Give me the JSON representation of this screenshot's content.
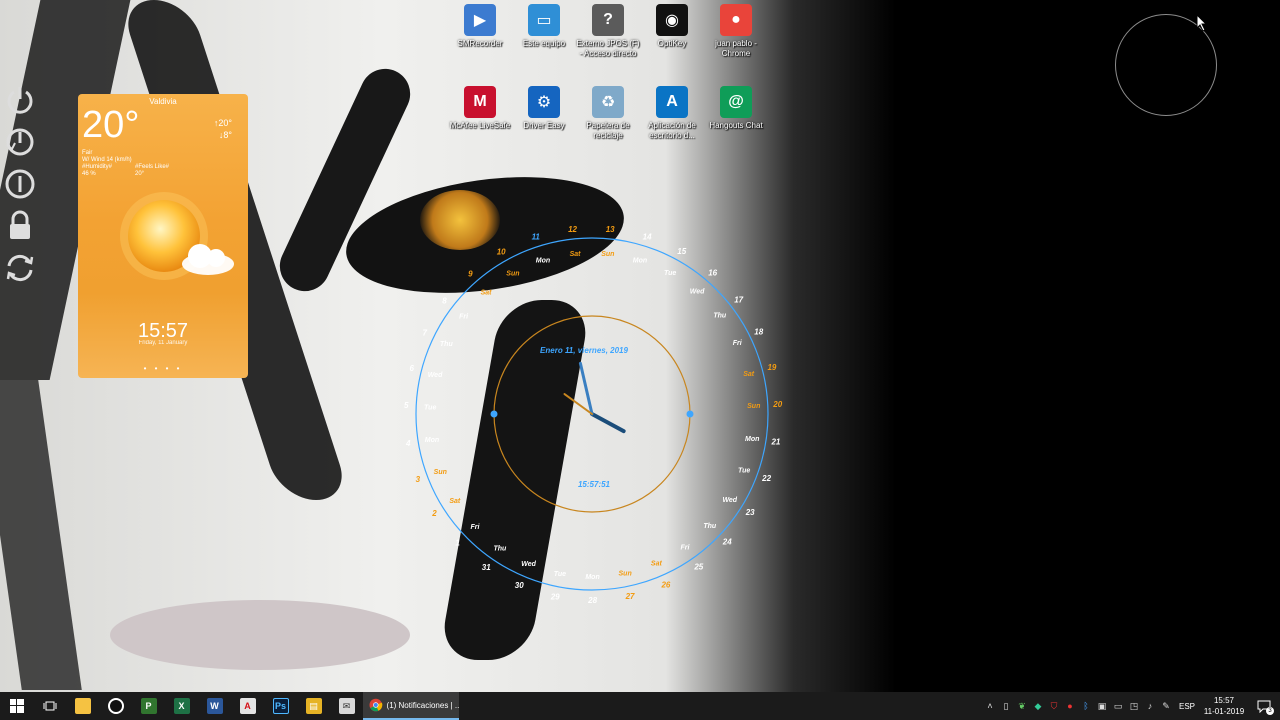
{
  "desktop": {
    "icons": [
      {
        "label": "SMRecorder",
        "icon": "film-icon",
        "color": "#3c7bd0",
        "glyph": "▶"
      },
      {
        "label": "Este equipo",
        "icon": "monitor-icon",
        "color": "#2f8fd6",
        "glyph": "▭"
      },
      {
        "label": "Externo JPOS (F) - Acceso directo",
        "icon": "drive-icon",
        "color": "#5b5b5b",
        "glyph": "?"
      },
      {
        "label": "OptiKey",
        "icon": "eye-icon",
        "color": "#111111",
        "glyph": "◉"
      },
      {
        "label": "juan pablo - Chrome",
        "icon": "chrome-icon",
        "color": "#e9443a",
        "glyph": "●"
      },
      {
        "label": "McAfee LiveSafe",
        "icon": "mcafee-icon",
        "color": "#c8102e",
        "glyph": "M"
      },
      {
        "label": "Driver Easy",
        "icon": "driver-easy-icon",
        "color": "#1565c0",
        "glyph": "⚙"
      },
      {
        "label": "Papelera de reciclaje",
        "icon": "recycle-bin-icon",
        "color": "#7fa9c9",
        "glyph": "♻"
      },
      {
        "label": "Aplicación de escritorio d...",
        "icon": "azure-icon",
        "color": "#0a74c5",
        "glyph": "A"
      },
      {
        "label": "Hangouts Chat",
        "icon": "hangouts-chat-icon",
        "color": "#0f9d58",
        "glyph": "@"
      }
    ]
  },
  "weather": {
    "city": "Valdivia",
    "temperature": "20°",
    "high": "↑20°",
    "low": "↓8°",
    "condition": "Fair",
    "wind": "W/ Wind 14 (km/h)",
    "humidity_label": "#Humidity#",
    "humidity_value": "46 %",
    "feels_label": "#Feels Like#",
    "feels_value": "20°",
    "time": "15:57",
    "date": "Friday, 11 January",
    "dots": "• • • •"
  },
  "clock": {
    "date_text": "Enero 11, viernes, 2019",
    "time_text": "15:57:51",
    "hour": 15,
    "minute": 57,
    "second": 51,
    "day_numbers_start": 12,
    "day_names_start": "Sat",
    "current_day": 11,
    "colors": {
      "weekday": "#ffffff",
      "weekend": "#f39c12",
      "today": "#3ea6ff",
      "ring": "#3ea6ff",
      "inner_ring": "#c8861f"
    }
  },
  "taskbar": {
    "chrome_task_label": "(1) Notificaciones | ...",
    "language": "ESP",
    "time": "15:57",
    "date": "11-01-2019",
    "notifications": "3"
  }
}
